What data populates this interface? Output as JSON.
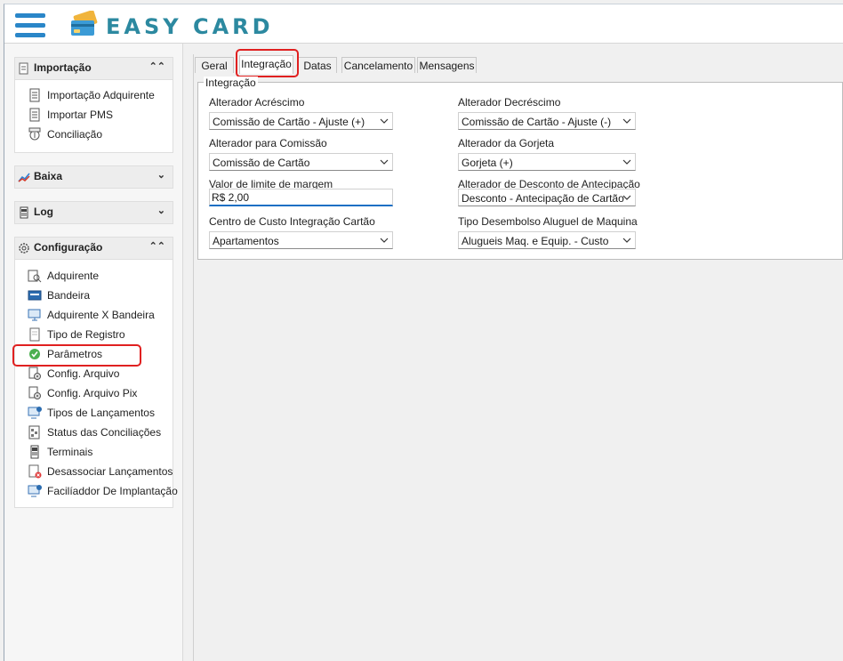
{
  "app": {
    "title": "EASY CARD"
  },
  "sidebar": {
    "panels": [
      {
        "title": "Importação",
        "icon": "document-import-icon",
        "state": "expanded",
        "items": [
          {
            "label": "Importação Adquirente",
            "icon": "document-icon"
          },
          {
            "label": "Importar PMS",
            "icon": "document-icon"
          },
          {
            "label": "Conciliação",
            "icon": "reconcile-icon"
          }
        ]
      },
      {
        "title": "Baixa",
        "icon": "chart-icon",
        "state": "collapsed",
        "items": []
      },
      {
        "title": "Log",
        "icon": "log-icon",
        "state": "collapsed",
        "items": []
      },
      {
        "title": "Configuração",
        "icon": "gear-icon",
        "state": "expanded",
        "items": [
          {
            "label": "Adquirente",
            "icon": "search-doc-icon"
          },
          {
            "label": "Bandeira",
            "icon": "card-icon"
          },
          {
            "label": "Adquirente X Bandeira",
            "icon": "monitor-icon"
          },
          {
            "label": "Tipo de Registro",
            "icon": "page-icon"
          },
          {
            "label": "Parâmetros",
            "icon": "check-circle-icon"
          },
          {
            "label": "Config. Arquivo",
            "icon": "file-gear-icon"
          },
          {
            "label": "Config. Arquivo Pix",
            "icon": "file-gear-icon"
          },
          {
            "label": "Tipos de Lançamentos",
            "icon": "monitor-info-icon"
          },
          {
            "label": "Status das Conciliações",
            "icon": "status-doc-icon"
          },
          {
            "label": "Terminais",
            "icon": "terminal-icon"
          },
          {
            "label": "Desassociar Lançamentos",
            "icon": "document-remove-icon"
          },
          {
            "label": "Facilíaddor De Implantação",
            "icon": "monitor-info-icon"
          }
        ]
      }
    ]
  },
  "tabs": [
    "Geral",
    "Integração",
    "Datas",
    "Cancelamento",
    "Mensagens"
  ],
  "active_tab": "Integração",
  "group": {
    "title": "Integração",
    "fields": {
      "alterador_acrescimo": {
        "label": "Alterador Acréscimo",
        "value": "Comissão de Cartão - Ajuste (+)"
      },
      "alterador_decrescimo": {
        "label": "Alterador Decréscimo",
        "value": "Comissão de Cartão - Ajuste (-)"
      },
      "alterador_comissao": {
        "label": "Alterador para Comissão",
        "value": "Comissão de Cartão"
      },
      "alterador_gorjeta": {
        "label": "Alterador da Gorjeta",
        "value": "Gorjeta (+)"
      },
      "valor_limite": {
        "label": "Valor de limite de margem",
        "value": "R$ 2,00"
      },
      "alterador_desconto": {
        "label": "Alterador de Desconto de Antecipação",
        "value": "Desconto - Antecipação de Cartão"
      },
      "centro_custo": {
        "label": "Centro de Custo Integração Cartão",
        "value": "Apartamentos"
      },
      "tipo_desembolso": {
        "label": "Tipo Desembolso Aluguel de Maquina",
        "value": "Alugueis Maq. e Equip. - Custo"
      }
    }
  },
  "colors": {
    "brand": "#2c89a0",
    "hamburger": "#2a86c8",
    "highlight": "#e02020",
    "focus": "#1a6fc4"
  }
}
